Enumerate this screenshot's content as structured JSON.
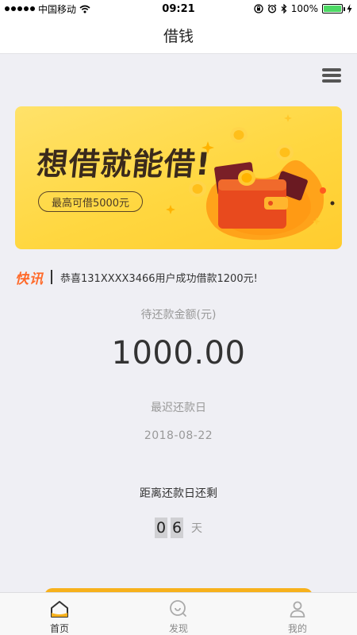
{
  "status_bar": {
    "carrier": "中国移动",
    "time": "09:21",
    "battery": "100%",
    "signal_icon": "signal-dots-icon",
    "wifi_icon": "wifi-icon",
    "lock_icon": "rotation-lock-icon",
    "alarm_icon": "alarm-icon",
    "bluetooth_icon": "bluetooth-icon",
    "charging_icon": "charging-bolt-icon"
  },
  "nav": {
    "title": "借钱"
  },
  "menu": {
    "icon": "hamburger-menu-icon"
  },
  "banner": {
    "headline": "想借就能借!",
    "pill": "最高可借5000元"
  },
  "ticker": {
    "badge": "快讯",
    "message": "恭喜131XXXX3466用户成功借款1200元!"
  },
  "repayment": {
    "due_label": "待还款金额(元)",
    "due_amount": "1000.00",
    "latest_label": "最迟还款日",
    "latest_date": "2018-08-22",
    "remain_label": "距离还款日还剩",
    "days_digits": [
      "0",
      "6"
    ],
    "days_unit": "天"
  },
  "tabs": [
    {
      "label": "首页",
      "icon": "home-icon",
      "active": true
    },
    {
      "label": "发现",
      "icon": "discover-icon",
      "active": false
    },
    {
      "label": "我的",
      "icon": "profile-icon",
      "active": false
    }
  ],
  "colors": {
    "accent_yellow": "#ffd740",
    "accent_orange": "#ff6a2a",
    "action_button": "#f7b11c",
    "background": "#efeff4"
  }
}
